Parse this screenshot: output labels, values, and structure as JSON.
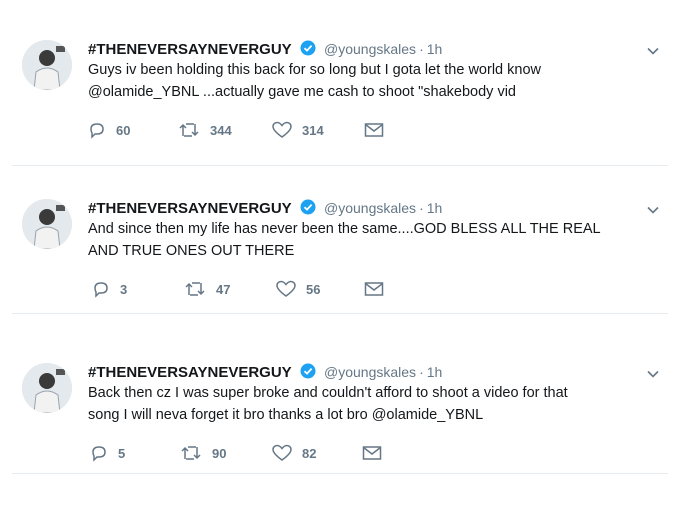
{
  "tweets": [
    {
      "name": "#THENEVERSAYNEVERGUY",
      "handle": "@youngskales",
      "separator": "·",
      "time": "1h",
      "line1": "Guys iv been holding this back for so long but I gota let the world know",
      "line2": "@olamide_YBNL ...actually gave me cash to shoot \"shakebody vid",
      "replies": "60",
      "retweets": "344",
      "likes": "314"
    },
    {
      "name": "#THENEVERSAYNEVERGUY",
      "handle": "@youngskales",
      "separator": "·",
      "time": "1h",
      "line1": "And since then my life has never been the same....GOD BLESS ALL THE REAL",
      "line2": "AND TRUE ONES OUT THERE",
      "replies": "3",
      "retweets": "47",
      "likes": "56"
    },
    {
      "name": "#THENEVERSAYNEVERGUY",
      "handle": "@youngskales",
      "separator": "·",
      "time": "1h",
      "line1": "Back then cz I was super broke and couldn't afford to shoot a video for that",
      "line2": "song I will neva forget it bro thanks a lot bro @olamide_YBNL",
      "replies": "5",
      "retweets": "90",
      "likes": "82"
    }
  ],
  "icons": {
    "reply": "reply-icon",
    "retweet": "retweet-icon",
    "like": "like-icon",
    "message": "message-icon",
    "verified": "verified-badge-icon",
    "caret": "chevron-down-icon"
  },
  "colors": {
    "verified": "#1da1f2",
    "muted": "#657786",
    "text": "#14171a",
    "border": "#e6ecf0"
  }
}
